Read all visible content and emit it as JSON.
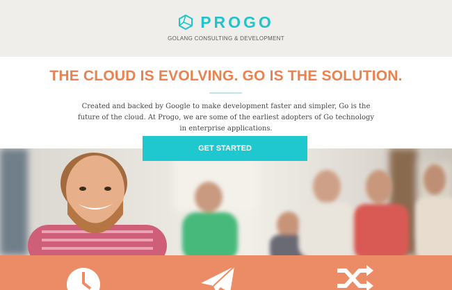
{
  "brand": {
    "name": "PROGO",
    "tagline": "GOLANG CONSULTING & DEVELOPMENT",
    "accent_color": "#1fc4cc"
  },
  "hero_text": {
    "headline": "THE CLOUD IS EVOLVING. GO IS THE SOLUTION.",
    "body": "Created and backed by Google to make development faster and simpler, Go is the future of the cloud. At Progo, we are some of the earliest adopters of Go technology in enterprise applications.",
    "headline_color": "#e9824f"
  },
  "cta": {
    "label": "GET STARTED",
    "color": "#1fc7cf"
  },
  "hero_image": {
    "icon": "team-photo"
  },
  "features": {
    "background": "#eb8c66",
    "icons": [
      "clock-icon",
      "paper-plane-icon",
      "shuffle-icon"
    ]
  }
}
